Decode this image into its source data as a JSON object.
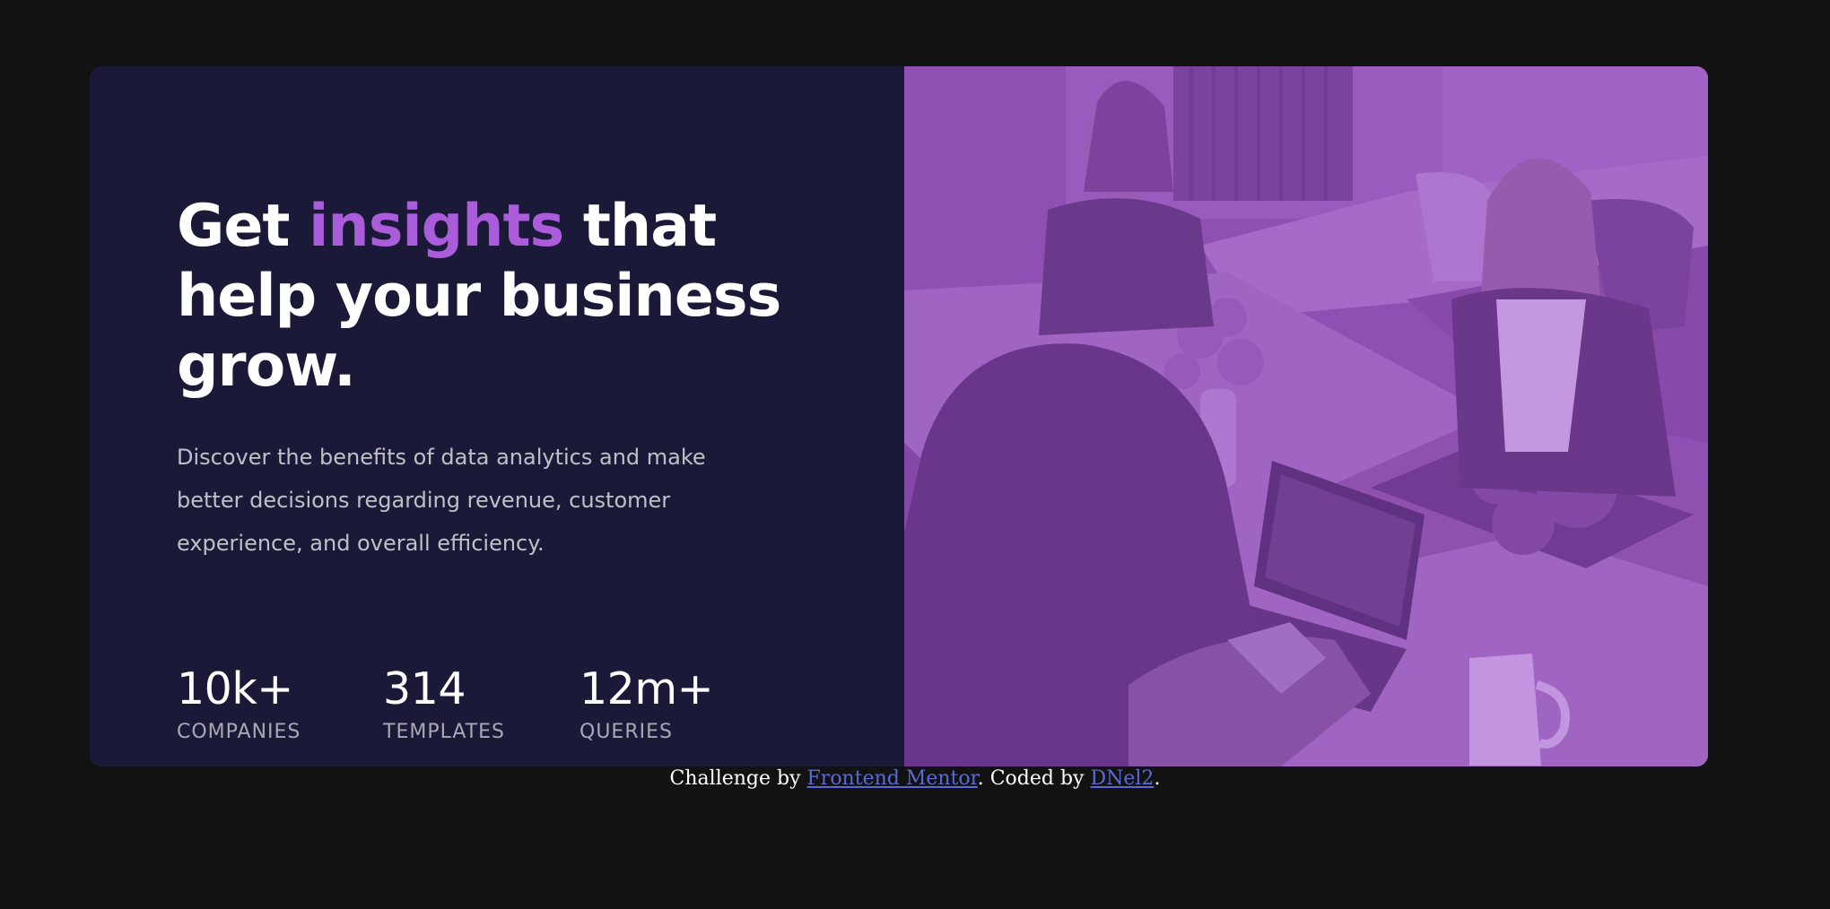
{
  "hero": {
    "headline_before": "Get ",
    "headline_accent": "insights",
    "headline_after": " that help your business grow.",
    "description": "Discover the benefits of data analytics and make better decisions regarding revenue, customer experience, and overall efficiency.",
    "stats": [
      {
        "value": "10k+",
        "label": "COMPANIES"
      },
      {
        "value": "314",
        "label": "TEMPLATES"
      },
      {
        "value": "12m+",
        "label": "QUERIES"
      }
    ]
  },
  "image": {
    "icon": "office-meeting-photo"
  },
  "footer": {
    "prefix": "Challenge by ",
    "link1": "Frontend Mentor",
    "middle": ". Coded by ",
    "link2": "DNel2",
    "suffix": "."
  },
  "colors": {
    "page_background": "#121212",
    "card_background": "#1b1938",
    "accent": "#aa5cdb",
    "photo_tint": "#aa5cdb",
    "link": "#5b69d8"
  }
}
